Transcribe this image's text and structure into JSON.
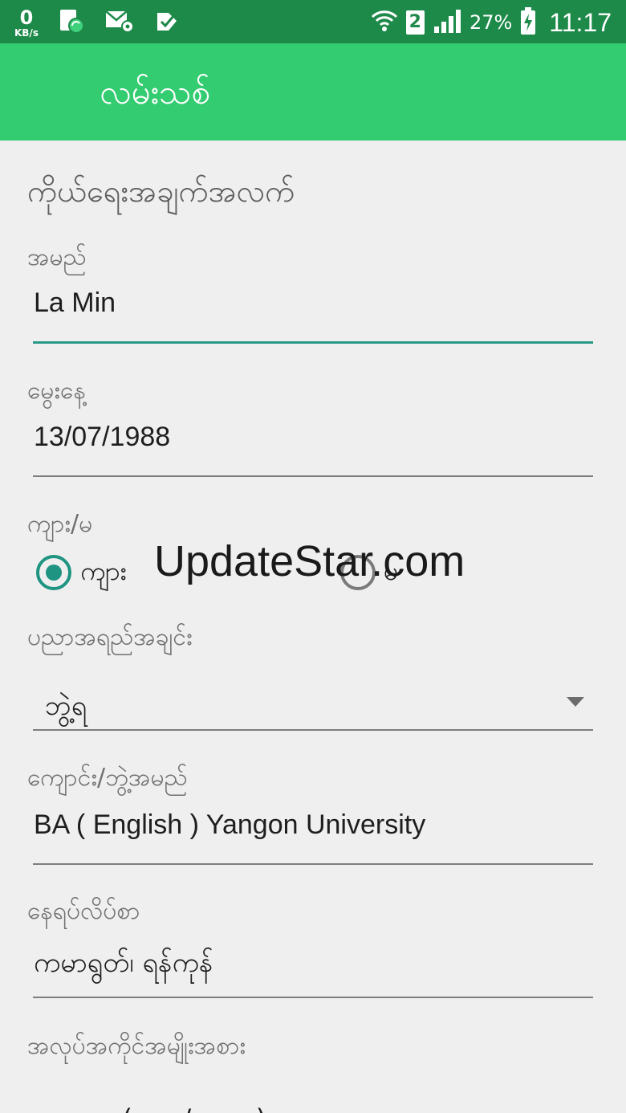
{
  "status_bar": {
    "data_speed_value": "0",
    "data_speed_unit": "KB/s",
    "sim_badge": "2",
    "battery_percent": "27%",
    "time": "11:17",
    "icons": [
      "sim-sync-icon",
      "mail-settings-icon",
      "task-check-icon",
      "wifi-icon",
      "signal-icon",
      "battery-charging-icon"
    ]
  },
  "app_bar": {
    "title": "လမ်းသစ်"
  },
  "form": {
    "section_title": "ကိုယ်ရေးအချက်အလက်",
    "name": {
      "label": "အမည်",
      "value": "La Min"
    },
    "dob": {
      "label": "မွေးနေ့",
      "value": "13/07/1988"
    },
    "gender": {
      "label": "ကျား/မ",
      "options": [
        {
          "label": "ကျား",
          "selected": true
        },
        {
          "label": "မ",
          "selected": false
        }
      ]
    },
    "education": {
      "label": "ပညာအရည်အချင်း",
      "selected": "ဘွဲ့ရ"
    },
    "school": {
      "label": "ကျောင်း/ဘွဲ့အမည်",
      "value": "BA ( English ) Yangon University"
    },
    "address": {
      "label": "နေရပ်လိပ်စာ",
      "value": "ကမာရွတ်၊ ရန်ကုန်"
    },
    "job_type": {
      "label": "အလုပ်အကိုင်အမျိုးအစား",
      "partial_value": "ပညာရေး (ဆရာ/ဆရာမ)"
    }
  },
  "watermark": "UpdateStar.com",
  "colors": {
    "status_bar": "#1e8a4a",
    "app_bar": "#33cc70",
    "accent": "#1f9482",
    "background": "#efefef"
  }
}
